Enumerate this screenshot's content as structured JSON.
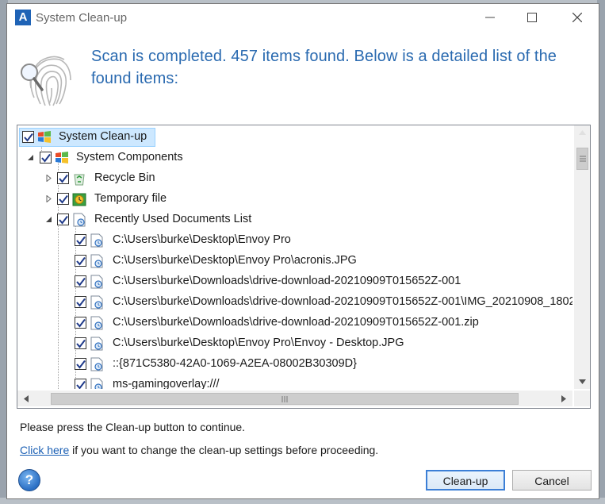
{
  "window": {
    "title": "System Clean-up",
    "logo_letter": "A"
  },
  "headline": "Scan is completed. 457 items found. Below is a detailed list of the found items:",
  "tree": {
    "root": "System Clean-up",
    "group": "System Components",
    "recycle_bin": "Recycle Bin",
    "temporary_file": "Temporary file",
    "recent_docs": "Recently Used Documents List",
    "items": [
      "C:\\Users\\burke\\Desktop\\Envoy Pro",
      "C:\\Users\\burke\\Desktop\\Envoy Pro\\acronis.JPG",
      "C:\\Users\\burke\\Downloads\\drive-download-20210909T015652Z-001",
      "C:\\Users\\burke\\Downloads\\drive-download-20210909T015652Z-001\\IMG_20210908_1802",
      "C:\\Users\\burke\\Downloads\\drive-download-20210909T015652Z-001.zip",
      "C:\\Users\\burke\\Desktop\\Envoy Pro\\Envoy - Desktop.JPG",
      "::{871C5380-42A0-1069-A2EA-08002B30309D}",
      "ms-gamingoverlay:///"
    ]
  },
  "footer": {
    "instruction": "Please press the Clean-up button to continue.",
    "link_text": "Click here",
    "link_suffix": " if you want to change the clean-up settings before proceeding."
  },
  "buttons": {
    "cleanup": "Clean-up",
    "cancel": "Cancel",
    "help": "?"
  },
  "colors": {
    "accent": "#2a6ab0",
    "selection": "#cde8ff",
    "link": "#1a5fb4"
  }
}
